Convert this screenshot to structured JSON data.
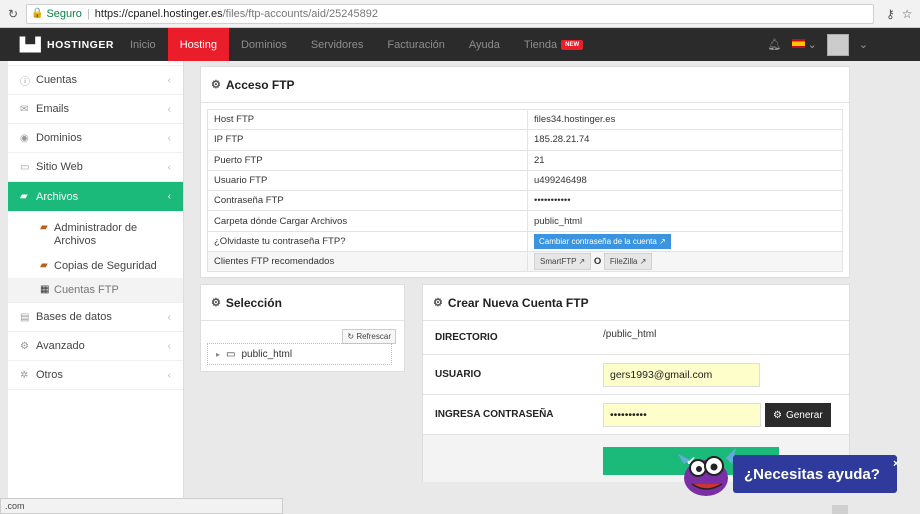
{
  "browser": {
    "secure_label": "Seguro",
    "url_host": "https://cpanel.hostinger.es",
    "url_path": "/files/ftp-accounts/aid/25245892",
    "status_text": ".com"
  },
  "topnav": {
    "logo": "HOSTINGER",
    "items": [
      {
        "label": "Inicio",
        "active": false
      },
      {
        "label": "Hosting",
        "active": true
      },
      {
        "label": "Dominios",
        "active": false
      },
      {
        "label": "Servidores",
        "active": false
      },
      {
        "label": "Facturación",
        "active": false
      },
      {
        "label": "Ayuda",
        "active": false
      },
      {
        "label": "Tienda",
        "active": false
      }
    ],
    "new_badge": "NEW"
  },
  "sidebar": {
    "items": [
      {
        "label": "Cuentas",
        "icon": "info-icon"
      },
      {
        "label": "Emails",
        "icon": "envelope-icon"
      },
      {
        "label": "Dominios",
        "icon": "globe-icon"
      },
      {
        "label": "Sitio Web",
        "icon": "monitor-icon"
      },
      {
        "label": "Archivos",
        "icon": "folder-icon"
      },
      {
        "label": "Bases de datos",
        "icon": "database-icon"
      },
      {
        "label": "Avanzado",
        "icon": "cogs-icon"
      },
      {
        "label": "Otros",
        "icon": "gear-icon"
      }
    ],
    "subitems": [
      {
        "label": "Administrador de Archivos"
      },
      {
        "label": "Copias de Seguridad"
      },
      {
        "label": "Cuentas FTP"
      }
    ]
  },
  "ftp_access": {
    "title": "Acceso FTP",
    "rows": [
      {
        "key": "Host FTP",
        "value": "files34.hostinger.es"
      },
      {
        "key": "IP FTP",
        "value": "185.28.21.74"
      },
      {
        "key": "Puerto FTP",
        "value": "21"
      },
      {
        "key": "Usuario FTP",
        "value": "u499246498"
      },
      {
        "key": "Contraseña FTP",
        "value": "•••••••••••"
      },
      {
        "key": "Carpeta dónde Cargar Archivos",
        "value": "public_html"
      }
    ],
    "forgot_label": "¿Olvidaste tu contraseña FTP?",
    "change_password_button": "Cambiar contraseña de la cuenta",
    "clients_label": "Clientes FTP recomendados",
    "client_smartftp": "SmartFTP",
    "client_or": "O",
    "client_filezilla": "FileZilla"
  },
  "selection": {
    "title": "Selección",
    "refresh_button": "Refrescar",
    "folder": "public_html"
  },
  "new_account": {
    "title": "Crear Nueva Cuenta FTP",
    "directory_label": "DIRECTORIO",
    "directory_value": "/public_html",
    "user_label": "USUARIO",
    "user_value": "gers1993@gmail.com",
    "password_label": "INGRESA CONTRASEÑA",
    "password_value": "••••••••••",
    "generate_button": "Generar"
  },
  "help_widget": {
    "label": "¿Necesitas ayuda?",
    "close": "×"
  }
}
